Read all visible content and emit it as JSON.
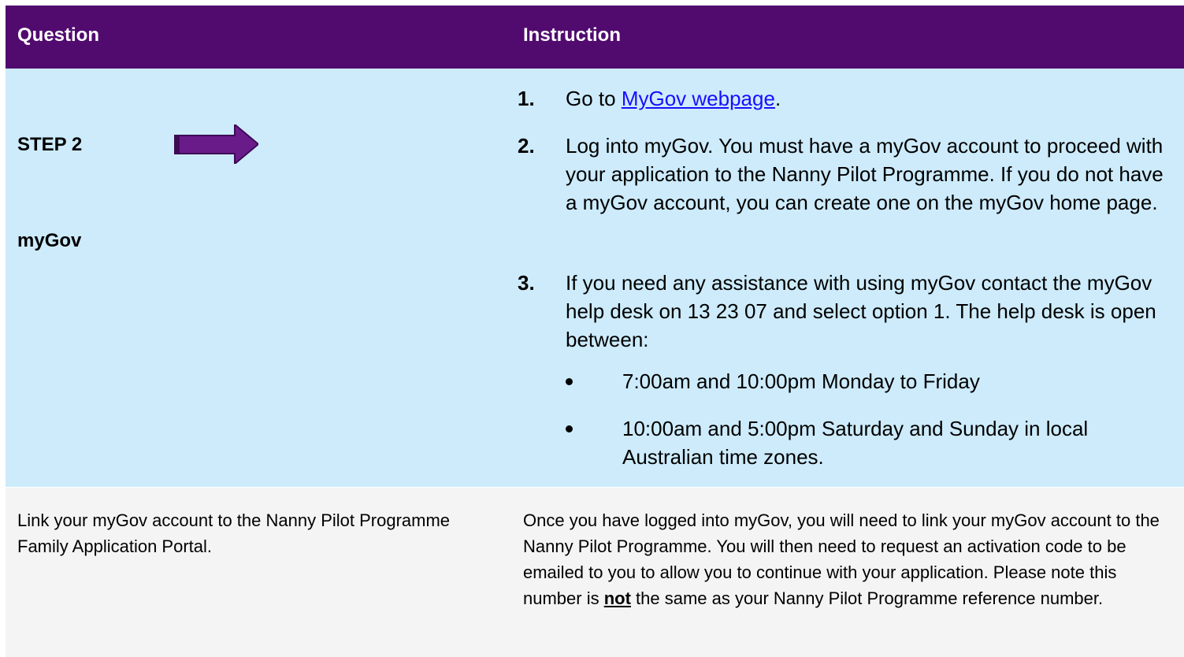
{
  "header": {
    "question": "Question",
    "instruction": "Instruction"
  },
  "step": {
    "label": "STEP 2",
    "name": "myGov",
    "items": [
      {
        "num": "1.",
        "pre": "Go to ",
        "link": "MyGov webpage",
        "post": "."
      },
      {
        "num": "2.",
        "text": "Log into myGov. You must have a myGov account to proceed with your application to the Nanny Pilot Programme. If you do not have a myGov account, you can create one on the myGov home page."
      },
      {
        "num": "3.",
        "text": "If you need any assistance with using myGov contact the myGov help desk on 13 23 07 and select option 1. The help desk is open between:"
      }
    ],
    "hours": [
      "7:00am and 10:00pm Monday to Friday",
      "10:00am and 5:00pm Saturday and Sunday in local Australian time zones."
    ]
  },
  "link_row": {
    "question": "Link your myGov account to the Nanny Pilot Programme Family Application Portal.",
    "instruction_pre": "Once you have logged into myGov, you will need to link your myGov account to the Nanny Pilot Programme. You will then need to request an activation code to be emailed to you to allow you to continue with your application. Please note this number is ",
    "instruction_bold": "not",
    "instruction_post": " the same as your Nanny Pilot Programme reference number."
  },
  "colors": {
    "header_bg": "#510b6f",
    "row_bg": "#cdebfb",
    "alt_row_bg": "#f4f4f4",
    "arrow": "#6a1b8a"
  }
}
